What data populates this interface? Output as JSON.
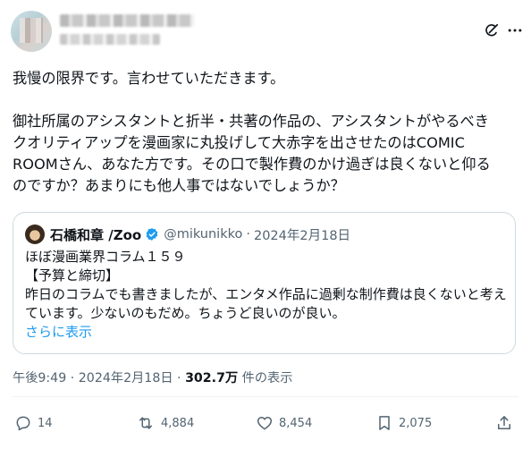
{
  "tweet": {
    "lines": [
      "我慢の限界です。言わせていただきます。",
      "",
      "御社所属のアシスタントと折半・共著の作品の、アシスタントがやるべき",
      "クオリティアップを漫画家に丸投げして大赤字を出させたのはCOMIC",
      "ROOMさん、あなた方です。その口で製作費のかけ過ぎは良くないと仰る",
      "のですか？あまりにも他人事ではないでしょうか？"
    ]
  },
  "quote": {
    "name": "石橋和章 /Zoo",
    "handle": "@mikunikko",
    "dot": "·",
    "date": "2024年2月18日",
    "lines": [
      "ほぼ漫画業界コラム１５９",
      "【予算と締切】",
      "昨日のコラムでも書きましたが、エンタメ作品に過剰な制作費は良くないと考え",
      "ています。少ないのもだめ。ちょうど良いのが良い。"
    ],
    "show_more": "さらに表示"
  },
  "meta": {
    "time": "午後9:49",
    "sep": " · ",
    "date": "2024年2月18日",
    "sep2": " · ",
    "views": "302.7万",
    "views_label": " 件の表示"
  },
  "actions": {
    "replies": "14",
    "retweets": "4,884",
    "likes": "8,454",
    "bookmarks": "2,075"
  },
  "colors": {
    "text": "#0f1419",
    "secondary": "#536471",
    "link": "#1d9bf0",
    "border": "#cfd9de"
  }
}
